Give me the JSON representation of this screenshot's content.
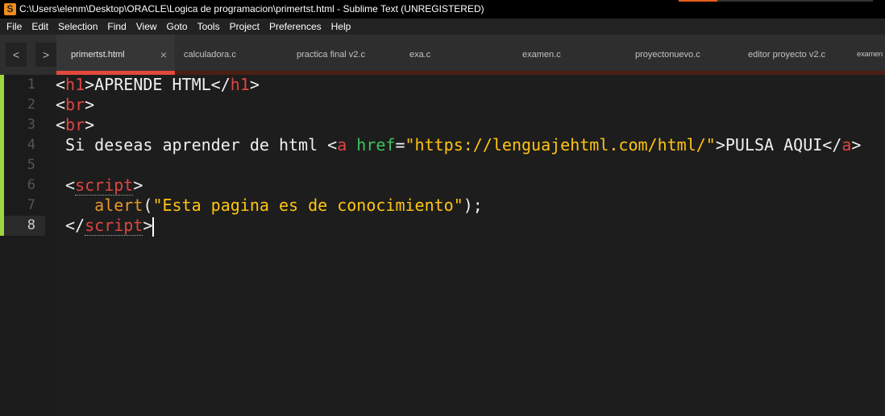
{
  "window": {
    "title": "C:\\Users\\elenm\\Desktop\\ORACLE\\Logica de programacion\\primertst.html - Sublime Text (UNREGISTERED)",
    "logo": "S"
  },
  "menu": [
    "File",
    "Edit",
    "Selection",
    "Find",
    "View",
    "Goto",
    "Tools",
    "Project",
    "Preferences",
    "Help"
  ],
  "nav": {
    "back": "<",
    "forward": ">"
  },
  "tabs": [
    {
      "label": "primertst.html",
      "active": true
    },
    {
      "label": "calculadora.c"
    },
    {
      "label": "practica final v2.c"
    },
    {
      "label": "exa.c"
    },
    {
      "label": "examen.c"
    },
    {
      "label": "proyectonuevo.c"
    },
    {
      "label": "editor proyecto v2.c"
    },
    {
      "label": "examen"
    }
  ],
  "tab_close": "×",
  "current_line": 8,
  "line_numbers": [
    "1",
    "2",
    "3",
    "4",
    "5",
    "6",
    "7",
    "8"
  ],
  "code": {
    "l1": [
      "<",
      "h1",
      ">APRENDE HTML</",
      "h1",
      ">"
    ],
    "l2": [
      "<",
      "br",
      ">"
    ],
    "l3": [
      "<",
      "br",
      ">"
    ],
    "l4": [
      " Si deseas aprender de html <",
      "a",
      " ",
      "href",
      "=",
      "\"https://lenguajehtml.com/html/\"",
      ">PULSA AQUI</",
      "a",
      ">"
    ],
    "l6": [
      " <",
      "script",
      ">"
    ],
    "l7": [
      "    ",
      "alert",
      "(",
      "\"Esta pagina es de conocimiento\"",
      ");"
    ],
    "l8": [
      " </",
      "script",
      ">"
    ]
  },
  "colors": {
    "tag": "#e04540",
    "attr": "#3cc55a",
    "string": "#ffc512",
    "function": "#e9962a",
    "accent": "#e2493b"
  }
}
